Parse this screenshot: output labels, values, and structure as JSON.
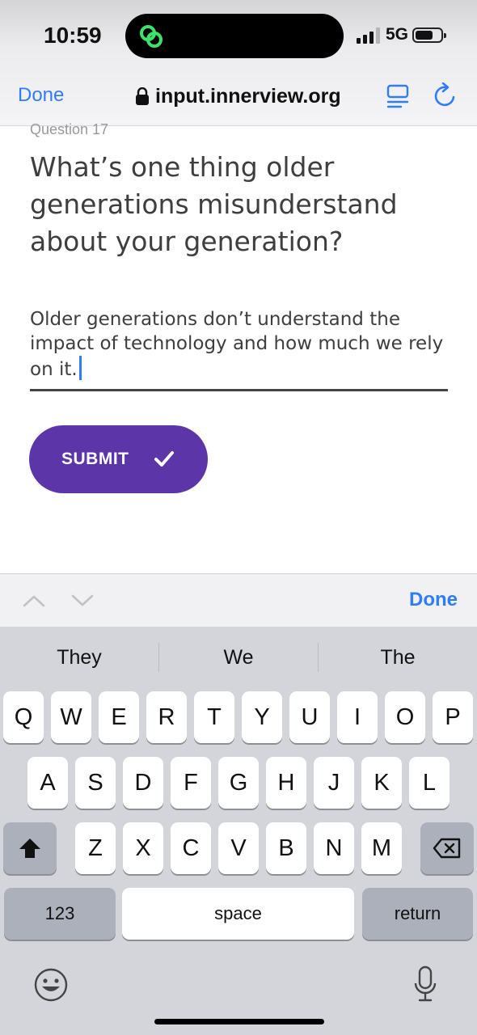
{
  "status_bar": {
    "time": "10:59",
    "network": "5G",
    "battery_level": 0.7
  },
  "browser": {
    "done_label": "Done",
    "url": "input.innerview.org",
    "reader_icon": "reader-icon",
    "reload_icon": "reload-icon"
  },
  "form": {
    "question_number": "Question 17",
    "question": "What’s one thing older generations misunderstand about your generation?",
    "answer": "Older generations don’t understand the impact of technology and how much we rely on it.",
    "submit_label": "SUBMIT",
    "accent": "#5c35a8"
  },
  "accessory": {
    "done_label": "Done"
  },
  "keyboard": {
    "suggestions": [
      "They",
      "We",
      "The"
    ],
    "row1": [
      "Q",
      "W",
      "E",
      "R",
      "T",
      "Y",
      "U",
      "I",
      "O",
      "P"
    ],
    "row2": [
      "A",
      "S",
      "D",
      "F",
      "G",
      "H",
      "J",
      "K",
      "L"
    ],
    "row3": [
      "Z",
      "X",
      "C",
      "V",
      "B",
      "N",
      "M"
    ],
    "numbers_label": "123",
    "space_label": "space",
    "return_label": "return"
  }
}
